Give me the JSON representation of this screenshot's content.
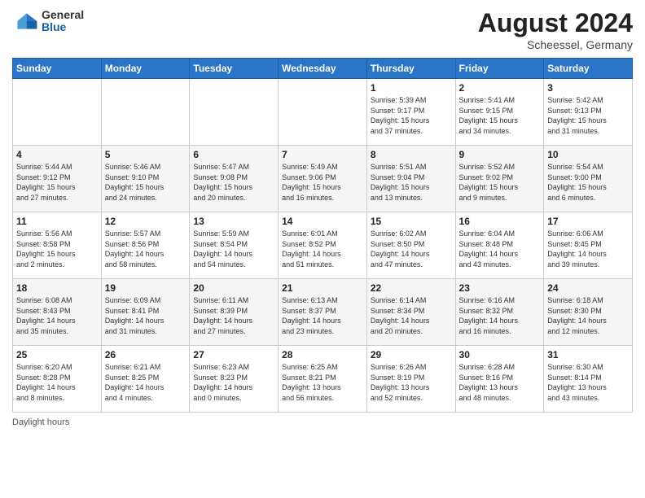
{
  "header": {
    "logo_general": "General",
    "logo_blue": "Blue",
    "month_year": "August 2024",
    "location": "Scheessel, Germany"
  },
  "days_of_week": [
    "Sunday",
    "Monday",
    "Tuesday",
    "Wednesday",
    "Thursday",
    "Friday",
    "Saturday"
  ],
  "footer": {
    "daylight_label": "Daylight hours"
  },
  "weeks": [
    [
      {
        "day": "",
        "info": ""
      },
      {
        "day": "",
        "info": ""
      },
      {
        "day": "",
        "info": ""
      },
      {
        "day": "",
        "info": ""
      },
      {
        "day": "1",
        "info": "Sunrise: 5:39 AM\nSunset: 9:17 PM\nDaylight: 15 hours\nand 37 minutes."
      },
      {
        "day": "2",
        "info": "Sunrise: 5:41 AM\nSunset: 9:15 PM\nDaylight: 15 hours\nand 34 minutes."
      },
      {
        "day": "3",
        "info": "Sunrise: 5:42 AM\nSunset: 9:13 PM\nDaylight: 15 hours\nand 31 minutes."
      }
    ],
    [
      {
        "day": "4",
        "info": "Sunrise: 5:44 AM\nSunset: 9:12 PM\nDaylight: 15 hours\nand 27 minutes."
      },
      {
        "day": "5",
        "info": "Sunrise: 5:46 AM\nSunset: 9:10 PM\nDaylight: 15 hours\nand 24 minutes."
      },
      {
        "day": "6",
        "info": "Sunrise: 5:47 AM\nSunset: 9:08 PM\nDaylight: 15 hours\nand 20 minutes."
      },
      {
        "day": "7",
        "info": "Sunrise: 5:49 AM\nSunset: 9:06 PM\nDaylight: 15 hours\nand 16 minutes."
      },
      {
        "day": "8",
        "info": "Sunrise: 5:51 AM\nSunset: 9:04 PM\nDaylight: 15 hours\nand 13 minutes."
      },
      {
        "day": "9",
        "info": "Sunrise: 5:52 AM\nSunset: 9:02 PM\nDaylight: 15 hours\nand 9 minutes."
      },
      {
        "day": "10",
        "info": "Sunrise: 5:54 AM\nSunset: 9:00 PM\nDaylight: 15 hours\nand 6 minutes."
      }
    ],
    [
      {
        "day": "11",
        "info": "Sunrise: 5:56 AM\nSunset: 8:58 PM\nDaylight: 15 hours\nand 2 minutes."
      },
      {
        "day": "12",
        "info": "Sunrise: 5:57 AM\nSunset: 8:56 PM\nDaylight: 14 hours\nand 58 minutes."
      },
      {
        "day": "13",
        "info": "Sunrise: 5:59 AM\nSunset: 8:54 PM\nDaylight: 14 hours\nand 54 minutes."
      },
      {
        "day": "14",
        "info": "Sunrise: 6:01 AM\nSunset: 8:52 PM\nDaylight: 14 hours\nand 51 minutes."
      },
      {
        "day": "15",
        "info": "Sunrise: 6:02 AM\nSunset: 8:50 PM\nDaylight: 14 hours\nand 47 minutes."
      },
      {
        "day": "16",
        "info": "Sunrise: 6:04 AM\nSunset: 8:48 PM\nDaylight: 14 hours\nand 43 minutes."
      },
      {
        "day": "17",
        "info": "Sunrise: 6:06 AM\nSunset: 8:45 PM\nDaylight: 14 hours\nand 39 minutes."
      }
    ],
    [
      {
        "day": "18",
        "info": "Sunrise: 6:08 AM\nSunset: 8:43 PM\nDaylight: 14 hours\nand 35 minutes."
      },
      {
        "day": "19",
        "info": "Sunrise: 6:09 AM\nSunset: 8:41 PM\nDaylight: 14 hours\nand 31 minutes."
      },
      {
        "day": "20",
        "info": "Sunrise: 6:11 AM\nSunset: 8:39 PM\nDaylight: 14 hours\nand 27 minutes."
      },
      {
        "day": "21",
        "info": "Sunrise: 6:13 AM\nSunset: 8:37 PM\nDaylight: 14 hours\nand 23 minutes."
      },
      {
        "day": "22",
        "info": "Sunrise: 6:14 AM\nSunset: 8:34 PM\nDaylight: 14 hours\nand 20 minutes."
      },
      {
        "day": "23",
        "info": "Sunrise: 6:16 AM\nSunset: 8:32 PM\nDaylight: 14 hours\nand 16 minutes."
      },
      {
        "day": "24",
        "info": "Sunrise: 6:18 AM\nSunset: 8:30 PM\nDaylight: 14 hours\nand 12 minutes."
      }
    ],
    [
      {
        "day": "25",
        "info": "Sunrise: 6:20 AM\nSunset: 8:28 PM\nDaylight: 14 hours\nand 8 minutes."
      },
      {
        "day": "26",
        "info": "Sunrise: 6:21 AM\nSunset: 8:25 PM\nDaylight: 14 hours\nand 4 minutes."
      },
      {
        "day": "27",
        "info": "Sunrise: 6:23 AM\nSunset: 8:23 PM\nDaylight: 14 hours\nand 0 minutes."
      },
      {
        "day": "28",
        "info": "Sunrise: 6:25 AM\nSunset: 8:21 PM\nDaylight: 13 hours\nand 56 minutes."
      },
      {
        "day": "29",
        "info": "Sunrise: 6:26 AM\nSunset: 8:19 PM\nDaylight: 13 hours\nand 52 minutes."
      },
      {
        "day": "30",
        "info": "Sunrise: 6:28 AM\nSunset: 8:16 PM\nDaylight: 13 hours\nand 48 minutes."
      },
      {
        "day": "31",
        "info": "Sunrise: 6:30 AM\nSunset: 8:14 PM\nDaylight: 13 hours\nand 43 minutes."
      }
    ]
  ]
}
